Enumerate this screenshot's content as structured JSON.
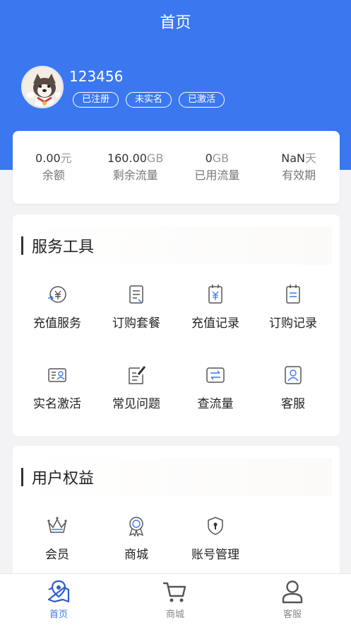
{
  "header": {
    "title": "首页"
  },
  "user": {
    "username": "123456",
    "badges": [
      "已注册",
      "未实名",
      "已激活"
    ]
  },
  "stats": [
    {
      "value": "0.00",
      "unit": "元",
      "label": "余额"
    },
    {
      "value": "160.00",
      "unit": "GB",
      "label": "剩余流量"
    },
    {
      "value": "0",
      "unit": "GB",
      "label": "已用流量"
    },
    {
      "value": "NaN",
      "unit": "天",
      "label": "有效期"
    }
  ],
  "services": {
    "title": "服务工具",
    "items": [
      {
        "label": "充值服务",
        "icon": "recharge-service-icon"
      },
      {
        "label": "订购套餐",
        "icon": "order-package-icon"
      },
      {
        "label": "充值记录",
        "icon": "recharge-record-icon"
      },
      {
        "label": "订购记录",
        "icon": "order-record-icon"
      },
      {
        "label": "实名激活",
        "icon": "id-card-icon"
      },
      {
        "label": "常见问题",
        "icon": "faq-icon"
      },
      {
        "label": "查流量",
        "icon": "traffic-query-icon"
      },
      {
        "label": "客服",
        "icon": "customer-service-icon"
      }
    ]
  },
  "rights": {
    "title": "用户权益",
    "items": [
      {
        "label": "会员",
        "icon": "crown-icon"
      },
      {
        "label": "商城",
        "icon": "medal-icon"
      },
      {
        "label": "账号管理",
        "icon": "shield-icon"
      }
    ]
  },
  "tabbar": {
    "items": [
      {
        "label": "首页",
        "icon": "map-pin-icon",
        "active": true
      },
      {
        "label": "商城",
        "icon": "cart-icon",
        "active": false
      },
      {
        "label": "客服",
        "icon": "user-icon",
        "active": false
      }
    ]
  },
  "colors": {
    "primary": "#3b78f0",
    "background": "#f3f3f5"
  }
}
